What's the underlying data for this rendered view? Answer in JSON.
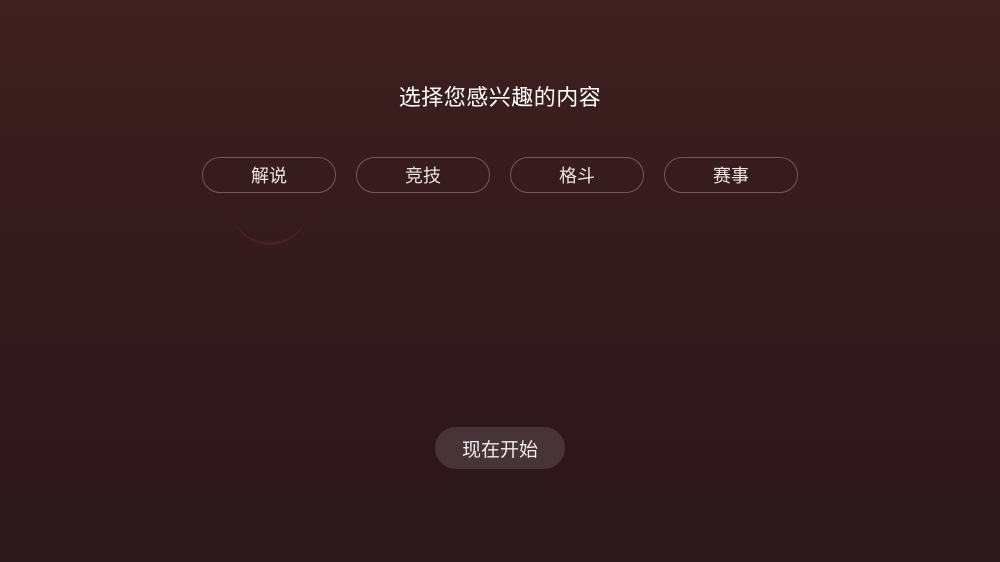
{
  "title": "选择您感兴趣的内容",
  "interests": [
    {
      "label": "解说"
    },
    {
      "label": "竞技"
    },
    {
      "label": "格斗"
    },
    {
      "label": "赛事"
    }
  ],
  "start_button": {
    "label": "现在开始"
  },
  "colors": {
    "background_top": "#3e201e",
    "background_bottom": "#2b171c",
    "chip_border": "rgba(255,255,255,0.28)",
    "button_fill": "rgba(255,255,255,0.12)",
    "text": "#ffffff"
  }
}
